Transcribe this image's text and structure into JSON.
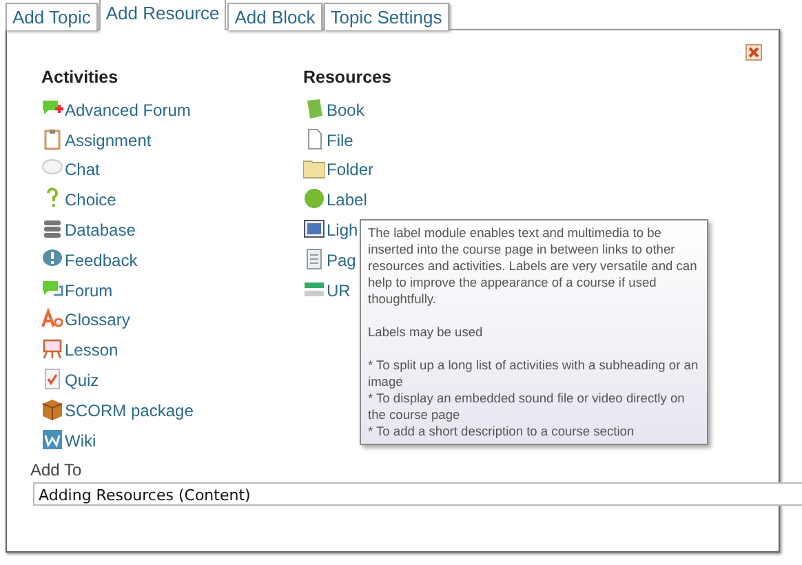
{
  "tabs": [
    {
      "label": "Add Topic",
      "selected": false
    },
    {
      "label": "Add Resource",
      "selected": true
    },
    {
      "label": "Add Block",
      "selected": false
    },
    {
      "label": "Topic Settings",
      "selected": false
    }
  ],
  "activities": {
    "heading": "Activities",
    "items": [
      "Advanced Forum",
      "Assignment",
      "Chat",
      "Choice",
      "Database",
      "Feedback",
      "Forum",
      "Glossary",
      "Lesson",
      "Quiz",
      "SCORM package",
      "Wiki"
    ]
  },
  "resources": {
    "heading": "Resources",
    "items": [
      "Book",
      "File",
      "Folder",
      "Label",
      "Ligh",
      "Pag",
      "UR"
    ]
  },
  "tooltip": {
    "paragraphs": [
      "The label module enables text and multimedia to be inserted into the course page in between links to other resources and activities. Labels are very versatile and can help to improve the appearance of a course if used thoughtfully.",
      "Labels may be used",
      "* To split up a long list of activities with a subheading or an image\n* To display an embedded sound file or video directly on the course page\n* To add a short description to a course section"
    ]
  },
  "add_to": {
    "label": "Add To",
    "value": "Adding Resources (Content)"
  }
}
